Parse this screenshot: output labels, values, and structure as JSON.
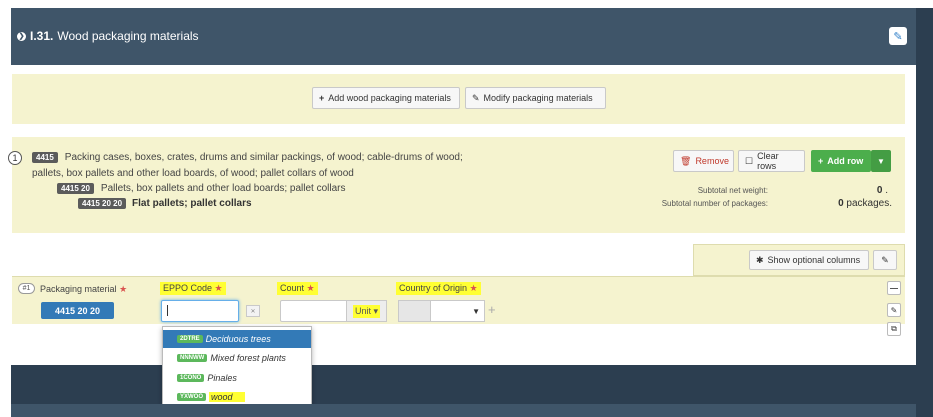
{
  "panel": {
    "title_code": "I.31.",
    "title_text": "Wood packaging materials"
  },
  "toolbar": {
    "add_label": "Add wood packaging materials",
    "modify_label": "Modify packaging materials"
  },
  "commodity": {
    "row_number": "1",
    "line1_code": "4415",
    "line1_text": "Packing cases, boxes, crates, drums and similar packings, of wood; cable-drums of wood;",
    "line2_text": "pallets, box pallets and other load boards, of wood; pallet collars of wood",
    "line3_code": "4415 20",
    "line3_text": "Pallets, box pallets and other load boards; pallet collars",
    "line4_code": "4415 20 20",
    "line4_text": "Flat pallets; pallet collars"
  },
  "actions": {
    "remove": "Remove",
    "clear_rows": "Clear rows",
    "add_row": "Add row"
  },
  "subtotals": {
    "weight_label": "Subtotal net weight:",
    "weight_value": "0",
    "weight_unit": ".",
    "packages_label": "Subtotal number of packages:",
    "packages_value": "0",
    "packages_unit": "packages."
  },
  "optional": {
    "show_label": "Show optional columns"
  },
  "form": {
    "row_tag": "#1",
    "packaging_material_label": "Packaging material",
    "packaging_material_value": "4415 20 20",
    "eppo_label": "EPPO Code",
    "count_label": "Count",
    "unit_label": "Unit",
    "country_label": "Country of Origin",
    "required_mark": "★"
  },
  "dropdown": {
    "items": [
      {
        "code": "2DTRE",
        "name": "Deciduous trees",
        "active": true
      },
      {
        "code": "NNNWW",
        "name": "Mixed forest plants",
        "active": false
      },
      {
        "code": "1CONO",
        "name": "Pinales",
        "active": false
      },
      {
        "code": "YXWOO",
        "name": "wood",
        "active": false,
        "highlighted": true
      }
    ]
  },
  "colors": {
    "header": "#3f5569",
    "panel_bg": "#f5f3cf",
    "primary": "#337ab7",
    "success": "#5cb85c",
    "highlight": "#ffff33"
  }
}
